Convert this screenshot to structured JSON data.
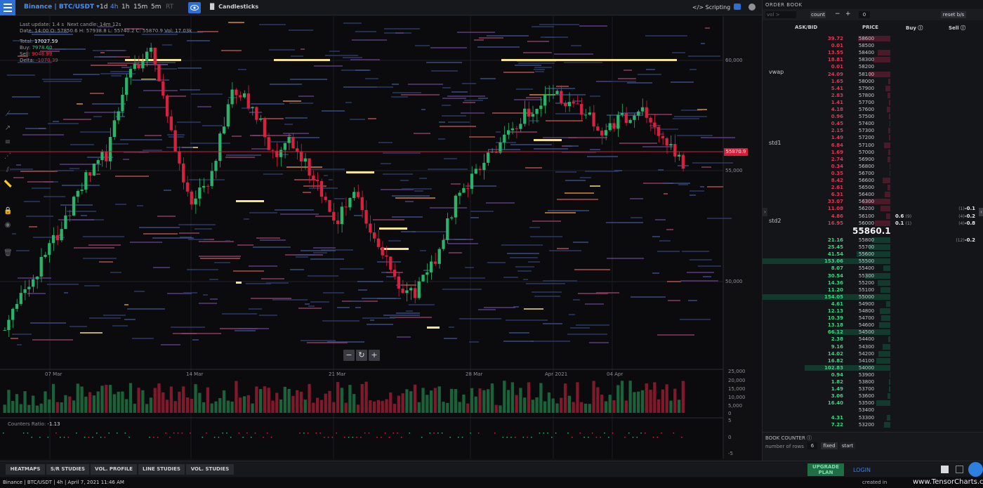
{
  "header": {
    "market": "Binance | BTC/USDT",
    "timeframes": [
      "1d",
      "4h",
      "1h",
      "15m",
      "5m",
      "RT"
    ],
    "active_timeframe": "4h",
    "chart_mode": "Candlesticks",
    "scripting": "Scripting"
  },
  "info": {
    "last_update": "Last update: 1.4 s",
    "next_candle": "Next candle: 14m 12s",
    "ohlc": "Date: 14:00 O: 57850.6 H: 57938.8 L: 55740.2 C: 55870.9 Vol: 17.03k",
    "total_label": "Total:",
    "total": "17027.59",
    "buy_label": "Buy:",
    "buy": "7978.60",
    "sell_label": "Sell:",
    "sell": "9048.99",
    "delta_label": "Delta:",
    "delta": "-1070.39"
  },
  "price_axis": {
    "labels": [
      "60,000",
      "55,000",
      "50,000"
    ],
    "current_price": "55870.9"
  },
  "time_axis": [
    "07 Mar",
    "14 Mar",
    "21 Mar",
    "28 Mar",
    "Apr 2021",
    "04 Apr"
  ],
  "volume_axis": [
    "25,000",
    "20,000",
    "15,000",
    "10,000",
    "5,000",
    "0"
  ],
  "counters_axis": [
    "5",
    "0",
    "-5"
  ],
  "counters": {
    "label": "Counters Ratio:",
    "value": "-1.13"
  },
  "zoom": {
    "minus": "−",
    "reset": "↻",
    "plus": "+"
  },
  "tabs": [
    "HEATMAPS",
    "S/R STUDIES",
    "VOL. PROFILE",
    "LINE STUDIES",
    "VOL. STUDIES"
  ],
  "upgrade": {
    "line1": "UPGRADE",
    "line2": "PLAN"
  },
  "login": "LOGIN",
  "status": "Binance | BTC/USDT | 4h | April 7, 2021 11:46 AM",
  "created_in": "created in",
  "brand": "www.TensorCharts.com",
  "orderbook": {
    "title": "ORDER BOOK",
    "vol_placeholder": "vol >",
    "count_label": "count",
    "step_value": "0",
    "reset_label": "reset b/s",
    "col_askbid": "ASK/BID",
    "col_price": "PRICE",
    "col_buy": "Buy",
    "col_sell": "Sell",
    "mid_price": "55860.1",
    "studies": [
      "vwap",
      "std1",
      "std2"
    ],
    "asks": [
      {
        "amt": "39.72",
        "price": "58600",
        "w": 46
      },
      {
        "amt": "0.01",
        "price": "58500",
        "w": 0
      },
      {
        "amt": "13.55",
        "price": "58400",
        "w": 18
      },
      {
        "amt": "18.81",
        "price": "58300",
        "w": 24
      },
      {
        "amt": "0.01",
        "price": "58200",
        "w": 0
      },
      {
        "amt": "24.09",
        "price": "58100",
        "w": 30
      },
      {
        "amt": "1.65",
        "price": "58000",
        "w": 3
      },
      {
        "amt": "5.41",
        "price": "57900",
        "w": 7
      },
      {
        "amt": "2.83",
        "price": "57800",
        "w": 4
      },
      {
        "amt": "1.41",
        "price": "57700",
        "w": 2
      },
      {
        "amt": "4.18",
        "price": "57600",
        "w": 5
      },
      {
        "amt": "0.96",
        "price": "57500",
        "w": 2
      },
      {
        "amt": "0.45",
        "price": "57400",
        "w": 1
      },
      {
        "amt": "2.15",
        "price": "57300",
        "w": 3
      },
      {
        "amt": "1.49",
        "price": "57200",
        "w": 2
      },
      {
        "amt": "6.84",
        "price": "57100",
        "w": 9
      },
      {
        "amt": "1.69",
        "price": "57000",
        "w": 3
      },
      {
        "amt": "2.74",
        "price": "56900",
        "w": 4
      },
      {
        "amt": "0.34",
        "price": "56800",
        "w": 1
      },
      {
        "amt": "0.35",
        "price": "56700",
        "w": 1
      },
      {
        "amt": "8.42",
        "price": "56600",
        "w": 11
      },
      {
        "amt": "2.61",
        "price": "56500",
        "w": 4
      },
      {
        "amt": "6.31",
        "price": "56400",
        "w": 8
      },
      {
        "amt": "33.07",
        "price": "56300",
        "w": 40
      },
      {
        "amt": "11.08",
        "price": "56200",
        "w": 14
      },
      {
        "amt": "4.86",
        "price": "56100",
        "w": 6
      },
      {
        "amt": "16.95",
        "price": "56000",
        "w": 22
      }
    ],
    "bids": [
      {
        "amt": "21.16",
        "price": "55800",
        "w": 26
      },
      {
        "amt": "25.45",
        "price": "55700",
        "w": 30
      },
      {
        "amt": "41.54",
        "price": "55600",
        "w": 48
      },
      {
        "amt": "153.06",
        "price": "55500",
        "w": 182
      },
      {
        "amt": "8.07",
        "price": "55400",
        "w": 10
      },
      {
        "amt": "30.54",
        "price": "55300",
        "w": 36
      },
      {
        "amt": "14.36",
        "price": "55200",
        "w": 18
      },
      {
        "amt": "11.20",
        "price": "55100",
        "w": 14
      },
      {
        "amt": "154.05",
        "price": "55000",
        "w": 182
      },
      {
        "amt": "4.61",
        "price": "54900",
        "w": 6
      },
      {
        "amt": "12.13",
        "price": "54800",
        "w": 15
      },
      {
        "amt": "10.39",
        "price": "54700",
        "w": 13
      },
      {
        "amt": "13.18",
        "price": "54600",
        "w": 16
      },
      {
        "amt": "66.12",
        "price": "54500",
        "w": 80
      },
      {
        "amt": "2.38",
        "price": "54400",
        "w": 3
      },
      {
        "amt": "9.16",
        "price": "54300",
        "w": 11
      },
      {
        "amt": "14.02",
        "price": "54200",
        "w": 17
      },
      {
        "amt": "16.82",
        "price": "54100",
        "w": 20
      },
      {
        "amt": "102.83",
        "price": "54000",
        "w": 122
      },
      {
        "amt": "0.94",
        "price": "53900",
        "w": 1
      },
      {
        "amt": "1.82",
        "price": "53800",
        "w": 2
      },
      {
        "amt": "1.49",
        "price": "53700",
        "w": 2
      },
      {
        "amt": "3.06",
        "price": "53600",
        "w": 4
      },
      {
        "amt": "16.40",
        "price": "53500",
        "w": 20
      },
      {
        "amt": "",
        "price": "53400",
        "w": 0
      },
      {
        "amt": "4.31",
        "price": "53300",
        "w": 5
      },
      {
        "amt": "7.22",
        "price": "53200",
        "w": 9
      }
    ],
    "buy_sell_rows": [
      {
        "price": "56100",
        "buy": "0.6",
        "buy_count": "(9)",
        "sell_count": "(4)",
        "sell": "-0.2"
      },
      {
        "price": "56000",
        "buy": "0.1",
        "buy_count": "(1)",
        "sell_count": "(4)",
        "sell": "-0.8"
      },
      {
        "price": "56200",
        "buy": "",
        "buy_count": "",
        "sell_count": "(1)",
        "sell": "-0.1"
      },
      {
        "price": "55800",
        "buy": "",
        "buy_count": "",
        "sell_count": "(12)",
        "sell": "-0.2"
      }
    ],
    "book_counter": {
      "title": "BOOK COUNTER",
      "rows_label": "number of rows",
      "rows_value": "6",
      "fixed": "fixed",
      "start": "start"
    }
  },
  "colors": {
    "accent": "#2d6fd6",
    "up": "#2ab36a",
    "down": "#d8203f",
    "ask_bar": "#4a1a28",
    "bid_bar": "#123a2d"
  }
}
